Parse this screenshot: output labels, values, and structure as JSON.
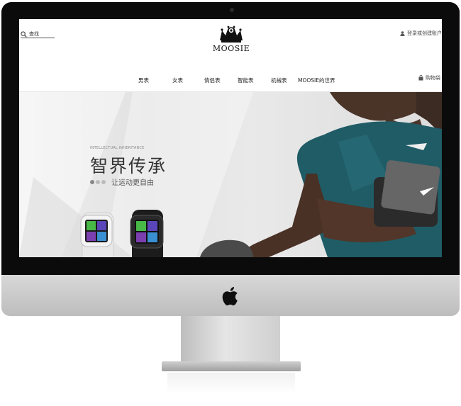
{
  "header": {
    "search_label": "查找",
    "brand": "MOOSIE",
    "login_label": "登录或创建账户",
    "cart_label": "购物袋"
  },
  "nav": {
    "items": [
      "男表",
      "女表",
      "情侣表",
      "智能表",
      "机械表",
      "MOOSIE的世界"
    ]
  },
  "hero": {
    "tag": "INTELLECTUAL INHERITANCE",
    "title": "智界传承",
    "subtitle": "让运动更自由"
  },
  "colors": {
    "bezel": "#0b0b0b",
    "shirt": "#1f5c66",
    "watch_screen": "#48b847"
  }
}
